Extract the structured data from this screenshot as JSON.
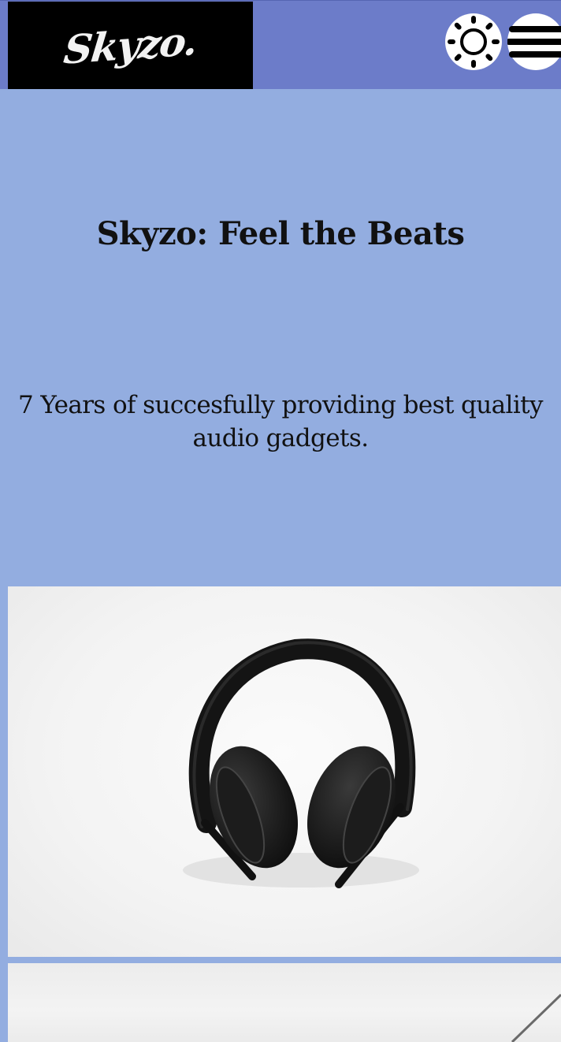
{
  "header": {
    "logo_text": "Skyzo.",
    "theme_icon": "sun-icon",
    "menu_icon": "hamburger-menu-icon"
  },
  "hero": {
    "title": "Skyzo: Feel the Beats",
    "subtitle": "7 Years of succesfully providing best quality audio gadgets."
  },
  "gallery": {
    "image_1": "headphones-photo",
    "image_2": "product-photo"
  },
  "colors": {
    "header_bg": "#6c7cc9",
    "page_bg": "#93ade0",
    "logo_bg": "#000000",
    "text": "#111111"
  }
}
